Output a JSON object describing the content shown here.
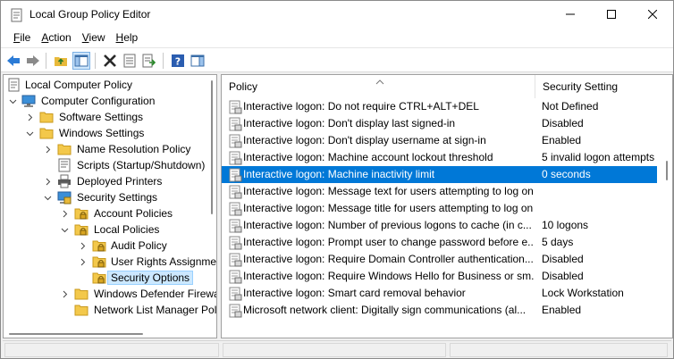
{
  "window": {
    "title": "Local Group Policy Editor"
  },
  "menubar": {
    "items": [
      {
        "label": "File",
        "underline": "F",
        "rest": "ile"
      },
      {
        "label": "Action",
        "underline": "A",
        "rest": "ction"
      },
      {
        "label": "View",
        "underline": "V",
        "rest": "iew"
      },
      {
        "label": "Help",
        "underline": "H",
        "rest": "elp"
      }
    ]
  },
  "toolbar": {
    "buttons": [
      "back-icon",
      "forward-icon",
      "up-folder-icon",
      "show-hide-tree-icon",
      "delete-icon",
      "properties-icon",
      "export-list-icon",
      "help-icon",
      "show-hide-action-pane-icon"
    ]
  },
  "tree": {
    "items": [
      {
        "label": "Local Computer Policy",
        "icon": "computer-policy-icon",
        "level": 0,
        "expander": "none"
      },
      {
        "label": "Computer Configuration",
        "icon": "computer-icon",
        "level": 1,
        "expander": "expanded"
      },
      {
        "label": "Software Settings",
        "icon": "folder-icon",
        "level": 2,
        "expander": "collapsed"
      },
      {
        "label": "Windows Settings",
        "icon": "folder-icon",
        "level": 2,
        "expander": "expanded"
      },
      {
        "label": "Name Resolution Policy",
        "icon": "folder-icon",
        "level": 3,
        "expander": "collapsed"
      },
      {
        "label": "Scripts (Startup/Shutdown)",
        "icon": "scripts-icon",
        "level": 3,
        "expander": "none"
      },
      {
        "label": "Deployed Printers",
        "icon": "printer-icon",
        "level": 3,
        "expander": "collapsed"
      },
      {
        "label": "Security Settings",
        "icon": "security-settings-icon",
        "level": 3,
        "expander": "expanded"
      },
      {
        "label": "Account Policies",
        "icon": "locked-folder-icon",
        "level": 4,
        "expander": "collapsed"
      },
      {
        "label": "Local Policies",
        "icon": "locked-folder-icon",
        "level": 4,
        "expander": "expanded"
      },
      {
        "label": "Audit Policy",
        "icon": "locked-folder-icon",
        "level": 5,
        "expander": "collapsed"
      },
      {
        "label": "User Rights Assignment",
        "icon": "locked-folder-icon",
        "level": 5,
        "expander": "collapsed"
      },
      {
        "label": "Security Options",
        "icon": "locked-folder-icon",
        "level": 5,
        "expander": "collapsed",
        "selected": true
      },
      {
        "label": "Windows Defender Firewall",
        "icon": "folder-icon",
        "level": 4,
        "expander": "collapsed"
      },
      {
        "label": "Network List Manager Policies",
        "icon": "folder-icon",
        "level": 4,
        "expander": "none"
      }
    ]
  },
  "list": {
    "columns": {
      "policy": "Policy",
      "setting": "Security Setting"
    },
    "rows": [
      {
        "policy": "Interactive logon: Do not require CTRL+ALT+DEL",
        "setting": "Not Defined"
      },
      {
        "policy": "Interactive logon: Don't display last signed-in",
        "setting": "Disabled"
      },
      {
        "policy": "Interactive logon: Don't display username at sign-in",
        "setting": "Enabled"
      },
      {
        "policy": "Interactive logon: Machine account lockout threshold",
        "setting": "5 invalid logon attempts"
      },
      {
        "policy": "Interactive logon: Machine inactivity limit",
        "setting": "0 seconds",
        "selected": true
      },
      {
        "policy": "Interactive logon: Message text for users attempting to log on",
        "setting": ""
      },
      {
        "policy": "Interactive logon: Message title for users attempting to log on",
        "setting": ""
      },
      {
        "policy": "Interactive logon: Number of previous logons to cache (in c...",
        "setting": "10 logons"
      },
      {
        "policy": "Interactive logon: Prompt user to change password before e...",
        "setting": "5 days"
      },
      {
        "policy": "Interactive logon: Require Domain Controller authentication...",
        "setting": "Disabled"
      },
      {
        "policy": "Interactive logon: Require Windows Hello for Business or sm...",
        "setting": "Disabled"
      },
      {
        "policy": "Interactive logon: Smart card removal behavior",
        "setting": "Lock Workstation"
      },
      {
        "policy": "Microsoft network client: Digitally sign communications (al...",
        "setting": "Enabled"
      }
    ]
  },
  "colors": {
    "selection": "#0078d7",
    "tree_selection": "#cce8ff",
    "folder": "#f3c84b"
  }
}
